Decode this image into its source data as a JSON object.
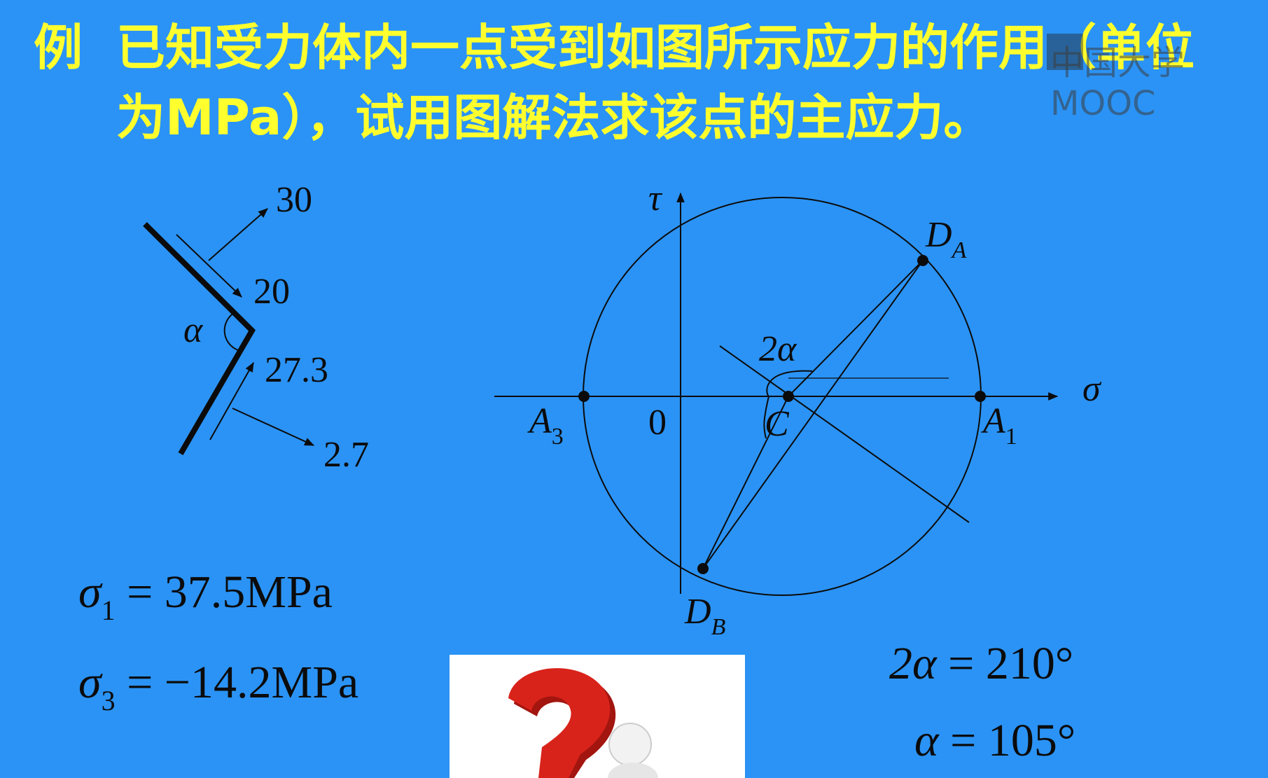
{
  "title": {
    "label": "例",
    "line1": "已知受力体内一点受到如图所示应力的作用（单位",
    "line2": "为MPa），试用图解法求该点的主应力。"
  },
  "watermark": "中国大学MOOC",
  "element_figure": {
    "labels": {
      "v30": "30",
      "v20": "20",
      "v273": "27.3",
      "v27": "2.7",
      "alpha": "α"
    }
  },
  "mohr_circle": {
    "axis_tau": "τ",
    "axis_sigma": "σ",
    "origin": "0",
    "point_DA": {
      "main": "D",
      "sub": "A"
    },
    "point_DB": {
      "main": "D",
      "sub": "B"
    },
    "point_A1": {
      "main": "A",
      "sub": "1"
    },
    "point_A3": {
      "main": "A",
      "sub": "3"
    },
    "point_C": "C",
    "angle_label": "2α"
  },
  "results": {
    "sigma1": {
      "sym": "σ",
      "sub": "1",
      "rhs": "= 37.5MPa"
    },
    "sigma3": {
      "sym": "σ",
      "sub": "3",
      "rhs": "= −14.2MPa"
    },
    "two_alpha": {
      "lhs": "2α",
      "rhs": "= 210°"
    },
    "alpha": {
      "lhs": "α",
      "rhs": "= 105°"
    }
  },
  "colors": {
    "background": "#2b93f5",
    "title": "#ffff2e",
    "ink": "#0b0b0b",
    "question_mark": "#d8231b"
  }
}
